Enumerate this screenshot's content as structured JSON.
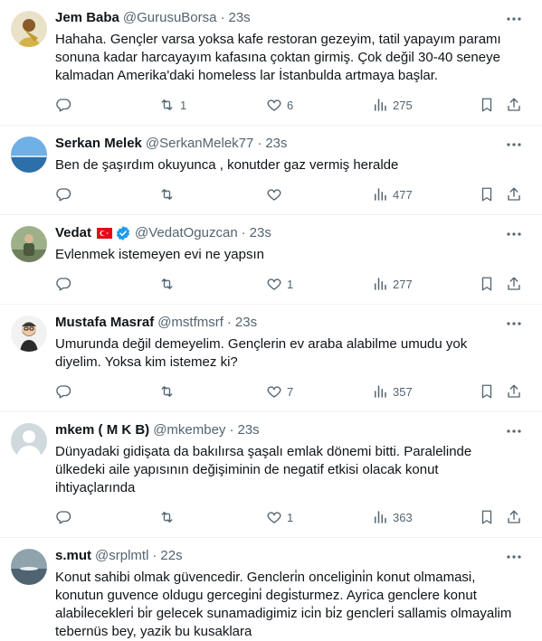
{
  "tweets": [
    {
      "name": "Jem Baba",
      "handle": "@GurusuBorsa",
      "dot": "·",
      "time": "23s",
      "text": "Hahaha. Gençler varsa yoksa kafe restoran gezeyim, tatil yapayım paramı sonuna kadar harcayayım kafasına çoktan girmiş. Çok değil 30-40 seneye kalmadan Amerika'daki homeless lar İstanbulda artmaya başlar.",
      "retweets": "1",
      "likes": "6",
      "views": "275"
    },
    {
      "name": "Serkan Melek",
      "handle": "@SerkanMelek77",
      "dot": "·",
      "time": "23s",
      "text": "Ben de şaşırdım okuyunca , konutder gaz vermiş heralde",
      "retweets": "",
      "likes": "",
      "views": "477"
    },
    {
      "name": "Vedat",
      "handle": "@VedatOguzcan",
      "dot": "·",
      "time": "23s",
      "text": "Evlenmek istemeyen evi ne yapsın",
      "retweets": "",
      "likes": "1",
      "views": "277"
    },
    {
      "name": "Mustafa Masraf",
      "handle": "@mstfmsrf",
      "dot": "·",
      "time": "23s",
      "text": "Umurunda değil demeyelim. Gençlerin ev araba alabilme umudu yok diyelim. Yoksa kim istemez ki?",
      "retweets": "",
      "likes": "7",
      "views": "357"
    },
    {
      "name": "mkem ( M K B)",
      "handle": "@mkembey",
      "dot": "·",
      "time": "23s",
      "text": "Dünyadaki gidişata da bakılırsa şaşalı emlak dönemi bitti. Paralelinde ülkedeki aile yapısının değişiminin de negatif etkisi olacak konut ihtiyaçlarında",
      "retweets": "",
      "likes": "1",
      "views": "363"
    },
    {
      "name": "s.mut",
      "handle": "@srplmtl",
      "dot": "·",
      "time": "22s",
      "text": "Konut sahibi olmak güvencedir. Gencleri̇n onceligi̇ni̇n konut olmamasi, konutun guvence oldugu gercegi̇ni̇ degi̇sturmez. Ayrica gencl̇ere konut alabi̇lecekleri̇ bi̇r gelecek sunamadigimiz ici̇n bi̇z gencleri̇ sallamis olmayalim tebernüs bey, yazik bu kusaklara"
    }
  ],
  "colors": {
    "text": "#0f1419",
    "secondary": "#536471",
    "divider": "#eff3f4",
    "verified": "#1d9bf0",
    "flag": "#e30a17"
  },
  "icons": [
    "reply-icon",
    "retweet-icon",
    "like-icon",
    "views-icon",
    "bookmark-icon",
    "share-icon",
    "more-icon",
    "verified-badge-icon",
    "turkey-flag-icon"
  ]
}
